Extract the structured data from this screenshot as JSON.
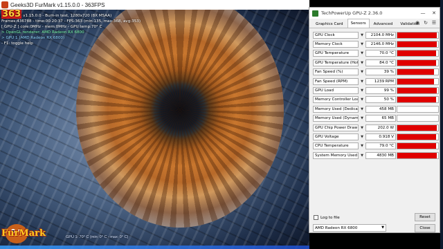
{
  "furmark": {
    "window_title": "Geeks3D FurMark v1.15.0.0 - 363FPS",
    "osd": {
      "fps_big": "363",
      "line1": "v1.15.0.0 - Burn-in test, 1280x720 (8X MSAA)",
      "line2": "Frames:436788 - time:00:20:37 - FPS:363 (min:135, max:368, avg:353)",
      "line3": "[ GPU-Z ] core:0MHz - mem:0MHz - GPU temp:70° C",
      "line4": "> OpenGL renderer: AMD Radeon RX 6800",
      "line5": "> GPU 1 (AMD Radeon RX 6800)",
      "line6": "- F1: toggle help"
    },
    "bottom_info": "GPU 1: 70° C (min: 0° C - max: 0° C)",
    "logo_text": "FurMark"
  },
  "gpuz": {
    "window_title": "TechPowerUp GPU-Z 2.36.0",
    "tabs": [
      {
        "label": "Graphics Card",
        "active": false
      },
      {
        "label": "Sensors",
        "active": true
      },
      {
        "label": "Advanced",
        "active": false
      },
      {
        "label": "Validation",
        "active": false
      }
    ],
    "sensors": [
      {
        "name": "GPU Clock",
        "value": "2104.0 MHz",
        "fill": 0.97
      },
      {
        "name": "Memory Clock",
        "value": "2146.0 MHz",
        "fill": 0.97
      },
      {
        "name": "GPU Temperature",
        "value": "70.0 °C",
        "fill": 0.95
      },
      {
        "name": "GPU Temperature (Hot Spot)",
        "value": "84.0 °C",
        "fill": 0.95
      },
      {
        "name": "Fan Speed (%)",
        "value": "39 %",
        "fill": 0.9
      },
      {
        "name": "Fan Speed (RPM)",
        "value": "1239 RPM",
        "fill": 0.9
      },
      {
        "name": "GPU Load",
        "value": "99 %",
        "fill": 0.97
      },
      {
        "name": "Memory Controller Load",
        "value": "50 %",
        "fill": 0.95
      },
      {
        "name": "Memory Used (Dedicated)",
        "value": "458 MB",
        "fill": 0
      },
      {
        "name": "Memory Used (Dynamic)",
        "value": "65 MB",
        "fill": 0
      },
      {
        "name": "GPU Chip Power Draw",
        "value": "202.0 W",
        "fill": 0.97
      },
      {
        "name": "GPU Voltage",
        "value": "0.918 V",
        "fill": 0.95
      },
      {
        "name": "CPU Temperature",
        "value": "79.0 °C",
        "fill": 0.95
      },
      {
        "name": "System Memory Used",
        "value": "4830 MB",
        "fill": 0.97
      }
    ],
    "log_label": "Log to file",
    "reset_label": "Reset",
    "gpu_selected": "AMD Radeon RX 6800",
    "close_label": "Close"
  },
  "colors": {
    "graph_fill": "#e00000",
    "fps_text": "#ffd23a"
  }
}
